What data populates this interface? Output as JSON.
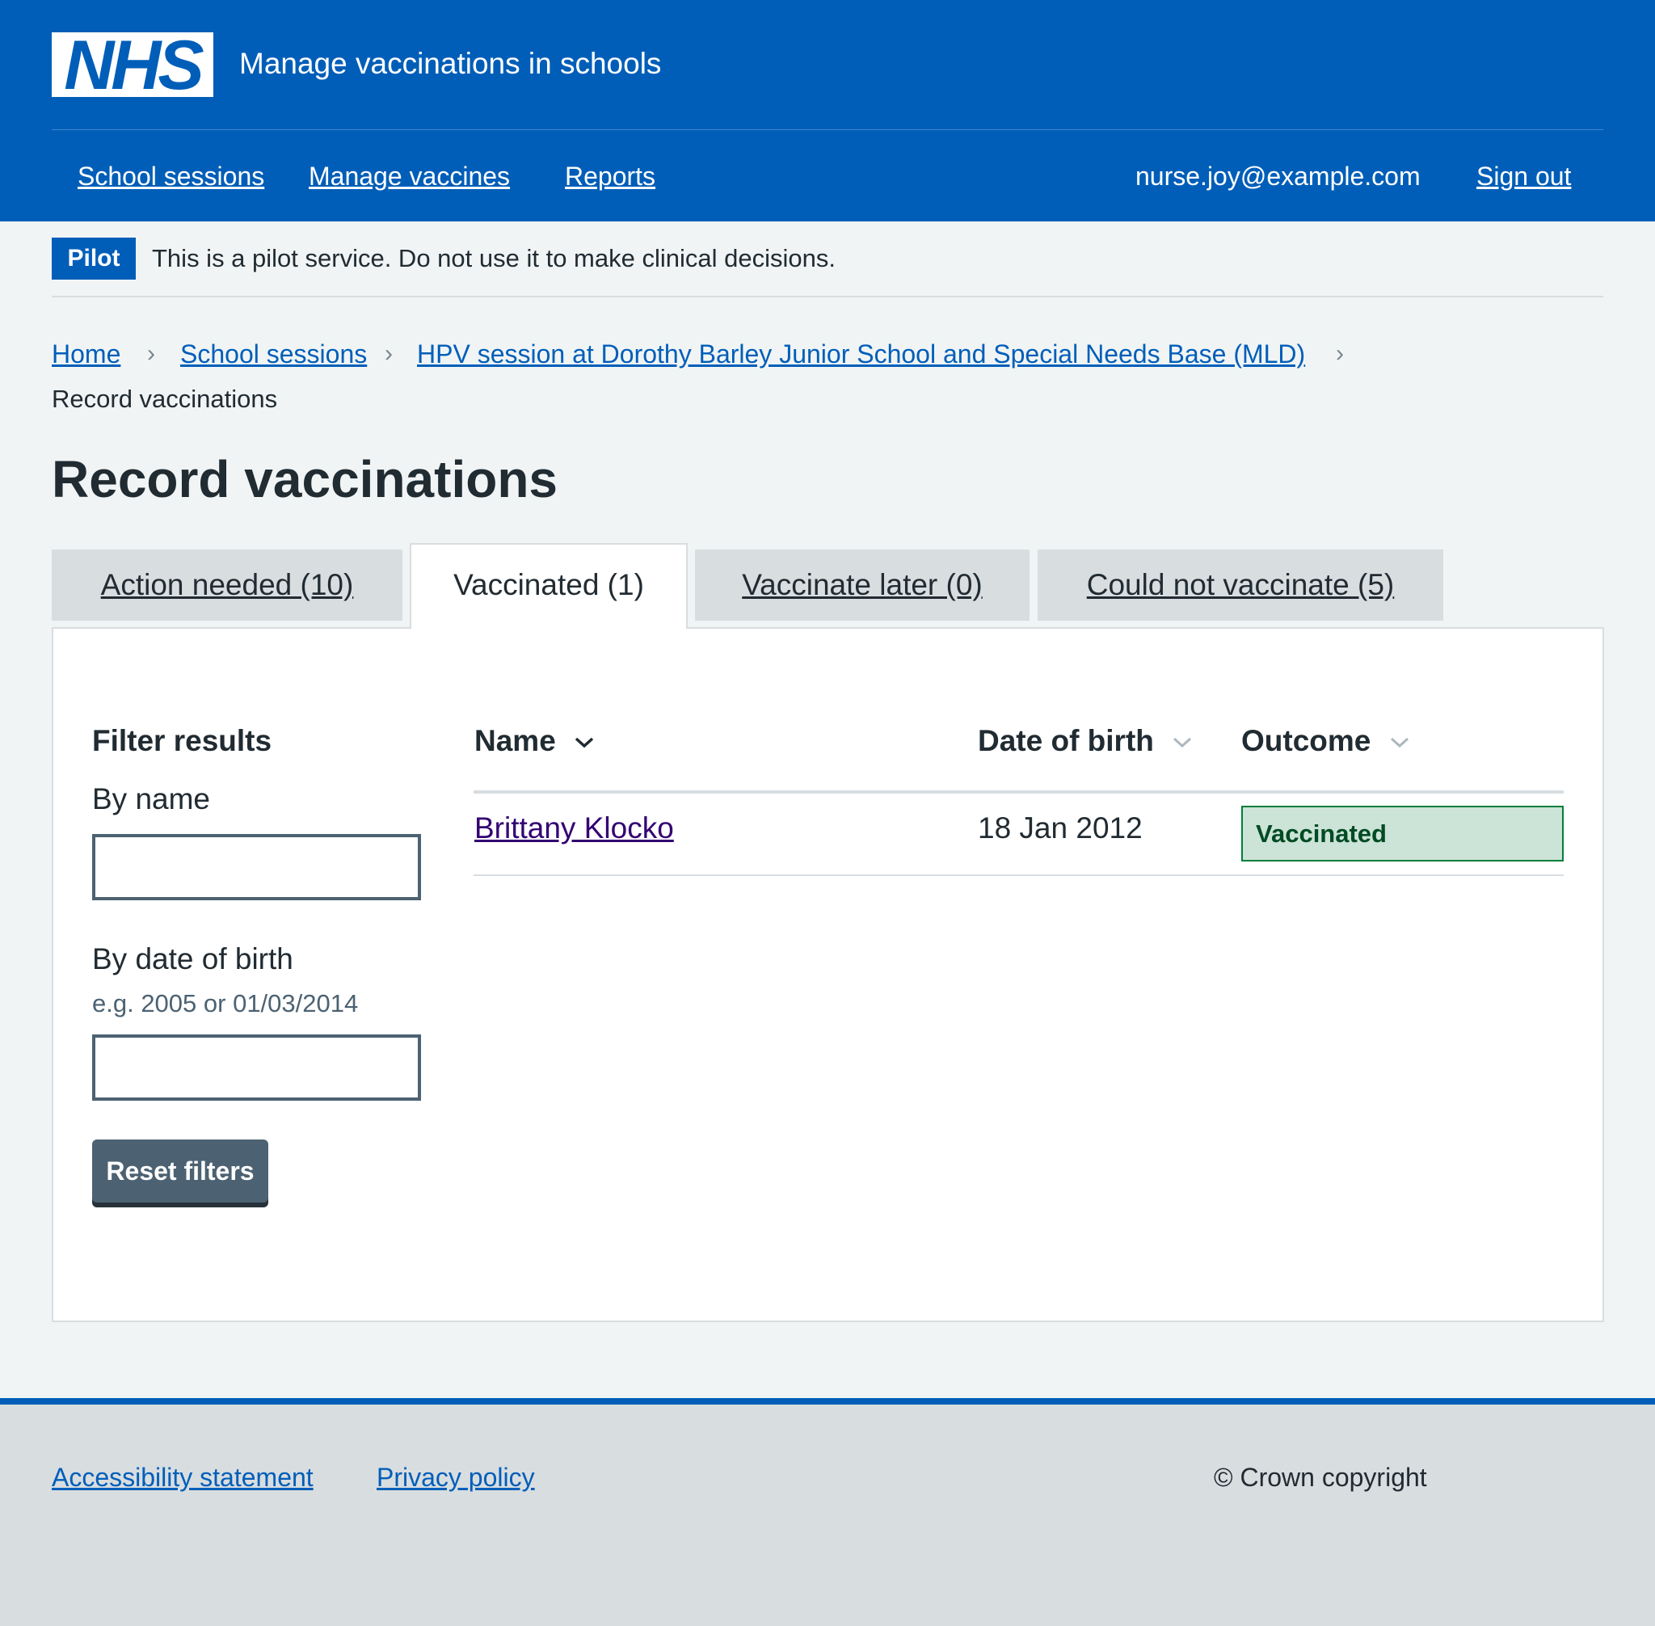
{
  "header": {
    "logo_text": "NHS",
    "service_name": "Manage vaccinations in schools",
    "nav": [
      "School sessions",
      "Manage vaccines",
      "Reports"
    ],
    "user_email": "nurse.joy@example.com",
    "sign_out": "Sign out"
  },
  "banner": {
    "tag": "Pilot",
    "text": "This is a pilot service. Do not use it to make clinical decisions."
  },
  "breadcrumb": {
    "items": [
      "Home",
      "School sessions",
      "HPV session at Dorothy Barley Junior School and Special Needs Base (MLD)"
    ],
    "current": "Record vaccinations"
  },
  "page_title": "Record vaccinations",
  "tabs": [
    {
      "label": "Action needed (10)",
      "active": false
    },
    {
      "label": "Vaccinated (1)",
      "active": true
    },
    {
      "label": "Vaccinate later (0)",
      "active": false
    },
    {
      "label": "Could not vaccinate (5)",
      "active": false
    }
  ],
  "filter": {
    "title": "Filter results",
    "by_name_label": "By name",
    "by_name_value": "",
    "by_dob_label": "By date of birth",
    "by_dob_hint": "e.g. 2005 or 01/03/2014",
    "by_dob_value": "",
    "reset_button": "Reset filters"
  },
  "table": {
    "headers": [
      "Name",
      "Date of birth",
      "Outcome"
    ],
    "rows": [
      {
        "name": "Brittany Klocko",
        "dob": "18 Jan 2012",
        "outcome": "Vaccinated"
      }
    ]
  },
  "footer": {
    "links": [
      "Accessibility statement",
      "Privacy policy"
    ],
    "copyright": "© Crown copyright"
  },
  "colors": {
    "nhs_blue": "#005eb8",
    "page_bg": "#f0f4f5",
    "success_bg": "#cce3d8",
    "success_text": "#004b22",
    "visited_link": "#330072"
  },
  "icons": [
    "chevron-right-icon",
    "chevron-down-icon"
  ]
}
